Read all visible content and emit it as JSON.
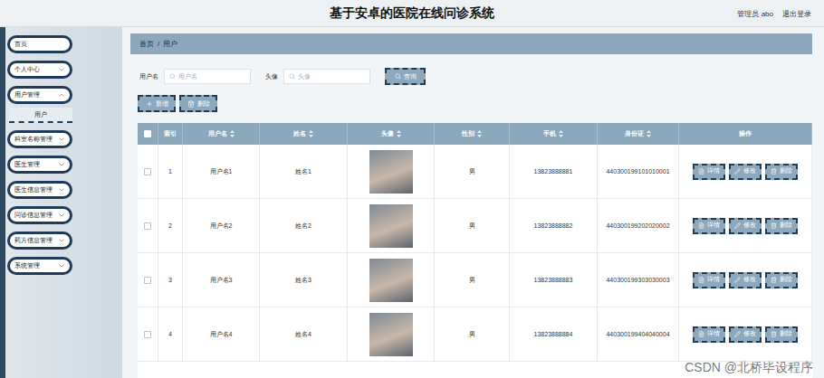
{
  "window": {
    "title": "基于安卓的医院在线问诊系统"
  },
  "header": {
    "user": "管理员 abo",
    "logout": "退出登录"
  },
  "sidebar": {
    "items": [
      {
        "label": "首页",
        "expandable": false,
        "expanded": false,
        "children": []
      },
      {
        "label": "个人中心",
        "expandable": true,
        "expanded": false,
        "children": []
      },
      {
        "label": "用户管理",
        "expandable": true,
        "expanded": true,
        "children": [
          {
            "label": "用户",
            "selected": true
          }
        ]
      },
      {
        "label": "科室名称管理",
        "expandable": true,
        "expanded": false,
        "children": []
      },
      {
        "label": "医生管理",
        "expandable": true,
        "expanded": false,
        "children": []
      },
      {
        "label": "医生信息管理",
        "expandable": true,
        "expanded": false,
        "children": []
      },
      {
        "label": "问诊信息管理",
        "expandable": true,
        "expanded": false,
        "children": []
      },
      {
        "label": "药方信息管理",
        "expandable": true,
        "expanded": false,
        "children": []
      },
      {
        "label": "系统管理",
        "expandable": true,
        "expanded": false,
        "children": []
      }
    ]
  },
  "breadcrumb": {
    "items": [
      "首页",
      "用户"
    ],
    "separator": "/"
  },
  "search": {
    "fields": [
      {
        "label": "用户名",
        "placeholder": "用户名"
      },
      {
        "label": "头像",
        "placeholder": "头像"
      }
    ],
    "button": "查询"
  },
  "toolbar": {
    "buttons": [
      {
        "label": "新增",
        "kind": "add"
      },
      {
        "label": "删除",
        "kind": "delete"
      }
    ]
  },
  "table": {
    "header_checked": false,
    "columns": [
      {
        "label": "索引",
        "sortable": false
      },
      {
        "label": "用户名",
        "sortable": true
      },
      {
        "label": "姓名",
        "sortable": true
      },
      {
        "label": "头像",
        "sortable": true
      },
      {
        "label": "性别",
        "sortable": true
      },
      {
        "label": "手机",
        "sortable": true
      },
      {
        "label": "身份证",
        "sortable": true
      },
      {
        "label": "操作",
        "sortable": false
      }
    ],
    "actions": [
      {
        "label": "详情",
        "kind": "detail"
      },
      {
        "label": "修改",
        "kind": "edit"
      },
      {
        "label": "删除",
        "kind": "delete"
      }
    ],
    "rows": [
      {
        "checked": false,
        "index": "1",
        "username": "用户名1",
        "name": "姓名1",
        "gender": "男",
        "phone": "13823888881",
        "id_card": "440300199101010001"
      },
      {
        "checked": false,
        "index": "2",
        "username": "用户名2",
        "name": "姓名2",
        "gender": "男",
        "phone": "13823888882",
        "id_card": "440300199202020002"
      },
      {
        "checked": false,
        "index": "3",
        "username": "用户名3",
        "name": "姓名3",
        "gender": "男",
        "phone": "13823888883",
        "id_card": "440300199303030003"
      },
      {
        "checked": false,
        "index": "4",
        "username": "用户名4",
        "name": "姓名4",
        "gender": "男",
        "phone": "13823888884",
        "id_card": "440300199404040004"
      }
    ]
  },
  "watermark": "CSDN @北桥毕设程序"
}
